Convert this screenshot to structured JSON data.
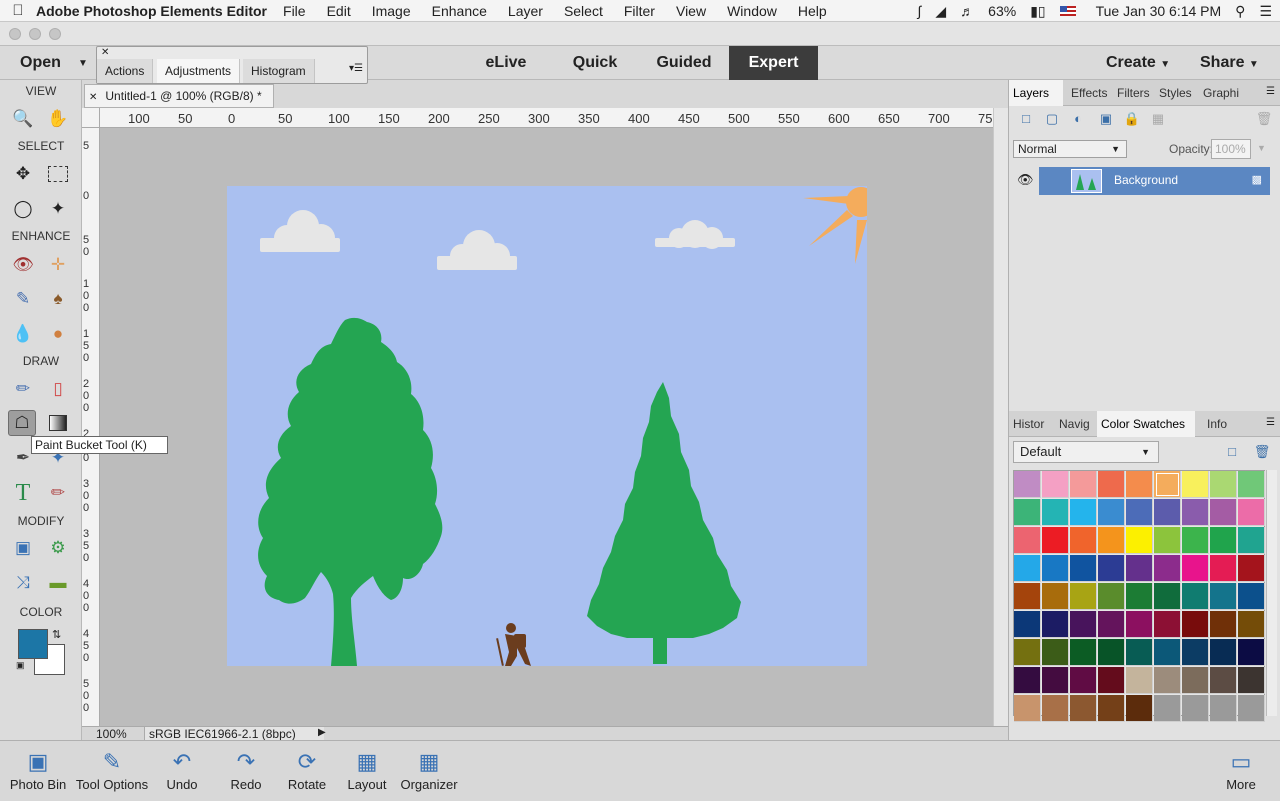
{
  "menubar": {
    "app_name": "Adobe Photoshop Elements Editor",
    "menus": [
      "File",
      "Edit",
      "Image",
      "Enhance",
      "Layer",
      "Select",
      "Filter",
      "View",
      "Window",
      "Help"
    ],
    "battery": "63%",
    "datetime": "Tue Jan 30  6:14 PM"
  },
  "topbar": {
    "open_label": "Open",
    "modes": [
      "eLive",
      "Quick",
      "Guided",
      "Expert"
    ],
    "active_mode": "Expert",
    "create_label": "Create",
    "share_label": "Share"
  },
  "float_panel": {
    "tabs": [
      "Actions",
      "Adjustments",
      "Histogram"
    ],
    "active": "Adjustments"
  },
  "toolbox": {
    "sections": [
      "VIEW",
      "SELECT",
      "ENHANCE",
      "DRAW",
      "MODIFY",
      "COLOR"
    ],
    "tooltip": "Paint Bucket Tool (K)",
    "foreground_color": "#1c76a6",
    "background_color": "#ffffff"
  },
  "document": {
    "tab_title": "Untitled-1 @ 100% (RGB/8) *",
    "ruler_top": [
      "100",
      "50",
      "0",
      "50",
      "100",
      "150",
      "200",
      "250",
      "300",
      "350",
      "400",
      "450",
      "500",
      "550",
      "600",
      "650",
      "700",
      "75"
    ],
    "ruler_left": [
      [
        "5"
      ],
      [
        "0"
      ],
      [
        "5",
        "0"
      ],
      [
        "1",
        "0",
        "0"
      ],
      [
        "1",
        "5",
        "0"
      ],
      [
        "2",
        "0",
        "0"
      ],
      [
        "2",
        "5",
        "0"
      ],
      [
        "3",
        "0",
        "0"
      ],
      [
        "3",
        "5",
        "0"
      ],
      [
        "4",
        "0",
        "0"
      ],
      [
        "4",
        "5",
        "0"
      ],
      [
        "5",
        "0",
        "0"
      ]
    ],
    "status_zoom": "100%",
    "status_profile": "sRGB IEC61966-2.1 (8bpc)",
    "canvas_bg": "#aac0f0"
  },
  "layers_panel": {
    "tabs": [
      "Layers",
      "Effects",
      "Filters",
      "Styles",
      "Graphi"
    ],
    "active_tab": "Layers",
    "blend_mode": "Normal",
    "opacity_label": "Opacity:",
    "opacity_value": "100%",
    "layer_name": "Background"
  },
  "swatches_panel": {
    "tabs": [
      "Histor",
      "Navig",
      "Color Swatches",
      "Info"
    ],
    "active_tab": "Color Swatches",
    "preset": "Default",
    "swatches": [
      "#c08cc4",
      "#f4a0c4",
      "#f49a9a",
      "#ee6a4c",
      "#f48c4c",
      "#f4ac5c",
      "#f8f05c",
      "#aad872",
      "#70c878",
      "#3cb478",
      "#24b4b4",
      "#24b4ec",
      "#3a8cd0",
      "#4c6cb8",
      "#5c5cac",
      "#8a5cac",
      "#a45ca4",
      "#ec6ca8",
      "#ec6470",
      "#ec1c24",
      "#f0642c",
      "#f4941c",
      "#fcf000",
      "#8cc43c",
      "#3cb44c",
      "#20a44c",
      "#20a490",
      "#24a8e8",
      "#1878c4",
      "#1054a0",
      "#2c3c94",
      "#64308c",
      "#8c2c8c",
      "#e8148c",
      "#e41c54",
      "#a4141c",
      "#a4440c",
      "#a86c0c",
      "#a8a414",
      "#5a8c2c",
      "#1c7c34",
      "#106c3c",
      "#107c70",
      "#14748c",
      "#0c508c",
      "#0c3878",
      "#1c1c64",
      "#48145c",
      "#64145c",
      "#8c1060",
      "#8c1034",
      "#780c0c",
      "#703008",
      "#744c08",
      "#747010",
      "#3c5c18",
      "#0c5c24",
      "#085428",
      "#085c54",
      "#0c5878",
      "#0c3c64",
      "#082c54",
      "#0c0c44",
      "#340c40",
      "#440c40",
      "#600c44",
      "#640c1c",
      "#c4b49c",
      "#9c8c7c",
      "#7c6c5c",
      "#5c4c44",
      "#3c3430",
      "#c8946c",
      "#a87048",
      "#8c5830",
      "#744018",
      "#5c2c0c",
      "#9a9a9a",
      "#9a9a9a",
      "#9a9a9a",
      "#9a9a9a"
    ]
  },
  "bottombar": {
    "buttons": [
      "Photo Bin",
      "Tool Options",
      "Undo",
      "Redo",
      "Rotate",
      "Layout",
      "Organizer"
    ],
    "more_label": "More"
  }
}
